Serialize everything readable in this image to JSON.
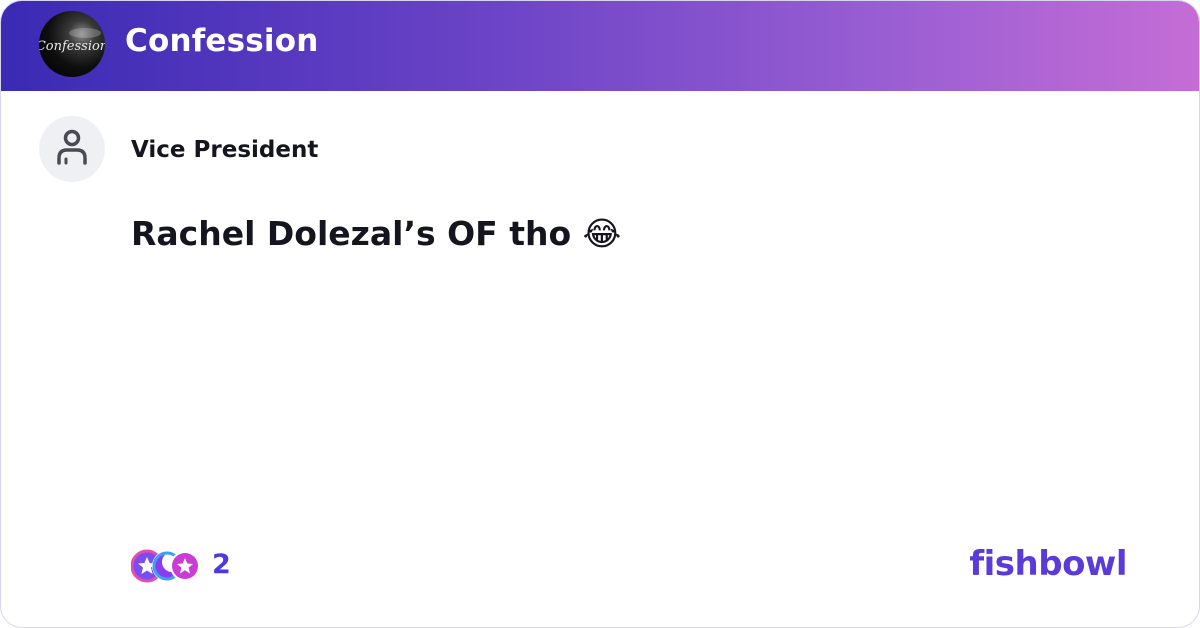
{
  "bowl": {
    "name": "Confession",
    "logo_text": "Confession"
  },
  "post": {
    "author": "Vice President",
    "text": "Rachel Dolezal’s OF tho 😂",
    "emoji_icon": "tears-of-joy-emoji-icon"
  },
  "reactions": {
    "count": "2",
    "icons": [
      "star-reaction-icon",
      "moon-reaction-icon",
      "star-reaction-icon"
    ]
  },
  "brand": {
    "name": "fishbowl"
  },
  "colors": {
    "header_gradient_start": "#3a2ab4",
    "header_gradient_end": "#c56dd6",
    "reaction_count": "#4a3ae0",
    "brand": "#5a3ad8"
  }
}
